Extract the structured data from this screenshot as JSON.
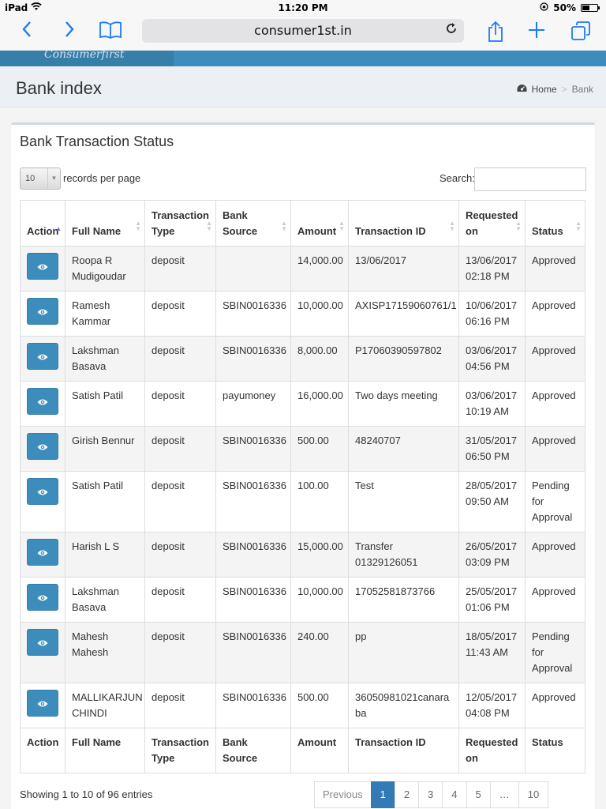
{
  "status_bar": {
    "device": "iPad",
    "time": "11:20 PM",
    "battery": "50%"
  },
  "browser": {
    "url": "consumer1st.in"
  },
  "site": {
    "brand": "Consumerfirst"
  },
  "page": {
    "title": "Bank index",
    "breadcrumb": {
      "home": "Home",
      "current": "Bank"
    }
  },
  "box": {
    "title": "Bank Transaction Status",
    "length_value": "10",
    "length_label": "records per page",
    "search_label": "Search:",
    "search_value": ""
  },
  "table": {
    "headers": [
      "Action",
      "Full Name",
      "Transaction Type",
      "Bank Source",
      "Amount",
      "Transaction ID",
      "Requested on",
      "Status"
    ],
    "rows": [
      {
        "name": "Roopa R Mudigoudar",
        "type": "deposit",
        "source": "",
        "amount": "14,000.00",
        "txn": "13/06/2017",
        "requested": "13/06/2017 02:18 PM",
        "status": "Approved"
      },
      {
        "name": "Ramesh Kammar",
        "type": "deposit",
        "source": "SBIN0016336",
        "amount": "10,000.00",
        "txn": "AXISP17159060761/1",
        "requested": "10/06/2017 06:16 PM",
        "status": "Approved"
      },
      {
        "name": "Lakshman Basava",
        "type": "deposit",
        "source": "SBIN0016336",
        "amount": "8,000.00",
        "txn": "P17060390597802",
        "requested": "03/06/2017 04:56 PM",
        "status": "Approved"
      },
      {
        "name": "Satish Patil",
        "type": "deposit",
        "source": "payumoney",
        "amount": "16,000.00",
        "txn": "Two days meeting",
        "requested": "03/06/2017 10:19 AM",
        "status": "Approved"
      },
      {
        "name": "Girish Bennur",
        "type": "deposit",
        "source": "SBIN0016336",
        "amount": "500.00",
        "txn": "48240707",
        "requested": "31/05/2017 06:50 PM",
        "status": "Approved"
      },
      {
        "name": "Satish Patil",
        "type": "deposit",
        "source": "SBIN0016336",
        "amount": "100.00",
        "txn": "Test",
        "requested": "28/05/2017 09:50 AM",
        "status": "Pending for Approval"
      },
      {
        "name": "Harish L S",
        "type": "deposit",
        "source": "SBIN0016336",
        "amount": "15,000.00",
        "txn": "Transfer 01329126051",
        "requested": "26/05/2017 03:09 PM",
        "status": "Approved"
      },
      {
        "name": "Lakshman Basava",
        "type": "deposit",
        "source": "SBIN0016336",
        "amount": "10,000.00",
        "txn": "17052581873766",
        "requested": "25/05/2017 01:06 PM",
        "status": "Approved"
      },
      {
        "name": "Mahesh Mahesh",
        "type": "deposit",
        "source": "SBIN0016336",
        "amount": "240.00",
        "txn": "pp",
        "requested": "18/05/2017 11:43 AM",
        "status": "Pending for Approval"
      },
      {
        "name": "MALLIKARJUN CHINDI",
        "type": "deposit",
        "source": "SBIN0016336",
        "amount": "500.00",
        "txn": "36050981021canara ba",
        "requested": "12/05/2017 04:08 PM",
        "status": "Approved"
      }
    ]
  },
  "footer": {
    "info": "Showing 1 to 10 of 96 entries",
    "pagination": {
      "previous": "Previous",
      "pages": [
        "1",
        "2",
        "3",
        "4",
        "5",
        "…",
        "10"
      ],
      "active": "1"
    }
  },
  "colors": {
    "primary": "#3c8dbc",
    "active_page": "#337ab7",
    "safari_blue": "#1a7cf5"
  },
  "icons": {
    "view": "eye-icon",
    "home": "dashboard-icon",
    "wifi": "wifi-icon",
    "reload": "reload-icon"
  }
}
